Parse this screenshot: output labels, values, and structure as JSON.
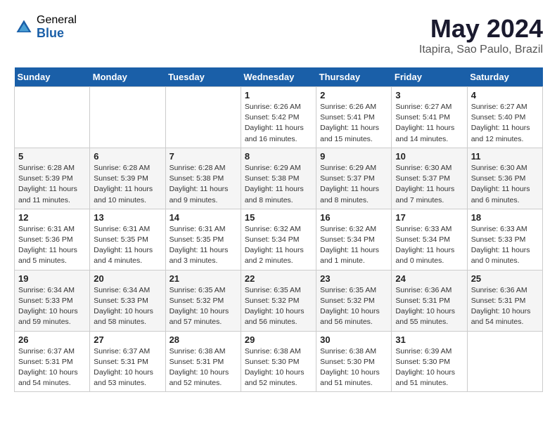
{
  "header": {
    "logo_general": "General",
    "logo_blue": "Blue",
    "month_year": "May 2024",
    "location": "Itapira, Sao Paulo, Brazil"
  },
  "days_of_week": [
    "Sunday",
    "Monday",
    "Tuesday",
    "Wednesday",
    "Thursday",
    "Friday",
    "Saturday"
  ],
  "weeks": [
    {
      "cells": [
        {
          "day": "",
          "info": ""
        },
        {
          "day": "",
          "info": ""
        },
        {
          "day": "",
          "info": ""
        },
        {
          "day": "1",
          "info": "Sunrise: 6:26 AM\nSunset: 5:42 PM\nDaylight: 11 hours and 16 minutes."
        },
        {
          "day": "2",
          "info": "Sunrise: 6:26 AM\nSunset: 5:41 PM\nDaylight: 11 hours and 15 minutes."
        },
        {
          "day": "3",
          "info": "Sunrise: 6:27 AM\nSunset: 5:41 PM\nDaylight: 11 hours and 14 minutes."
        },
        {
          "day": "4",
          "info": "Sunrise: 6:27 AM\nSunset: 5:40 PM\nDaylight: 11 hours and 12 minutes."
        }
      ]
    },
    {
      "cells": [
        {
          "day": "5",
          "info": "Sunrise: 6:28 AM\nSunset: 5:39 PM\nDaylight: 11 hours and 11 minutes."
        },
        {
          "day": "6",
          "info": "Sunrise: 6:28 AM\nSunset: 5:39 PM\nDaylight: 11 hours and 10 minutes."
        },
        {
          "day": "7",
          "info": "Sunrise: 6:28 AM\nSunset: 5:38 PM\nDaylight: 11 hours and 9 minutes."
        },
        {
          "day": "8",
          "info": "Sunrise: 6:29 AM\nSunset: 5:38 PM\nDaylight: 11 hours and 8 minutes."
        },
        {
          "day": "9",
          "info": "Sunrise: 6:29 AM\nSunset: 5:37 PM\nDaylight: 11 hours and 8 minutes."
        },
        {
          "day": "10",
          "info": "Sunrise: 6:30 AM\nSunset: 5:37 PM\nDaylight: 11 hours and 7 minutes."
        },
        {
          "day": "11",
          "info": "Sunrise: 6:30 AM\nSunset: 5:36 PM\nDaylight: 11 hours and 6 minutes."
        }
      ]
    },
    {
      "cells": [
        {
          "day": "12",
          "info": "Sunrise: 6:31 AM\nSunset: 5:36 PM\nDaylight: 11 hours and 5 minutes."
        },
        {
          "day": "13",
          "info": "Sunrise: 6:31 AM\nSunset: 5:35 PM\nDaylight: 11 hours and 4 minutes."
        },
        {
          "day": "14",
          "info": "Sunrise: 6:31 AM\nSunset: 5:35 PM\nDaylight: 11 hours and 3 minutes."
        },
        {
          "day": "15",
          "info": "Sunrise: 6:32 AM\nSunset: 5:34 PM\nDaylight: 11 hours and 2 minutes."
        },
        {
          "day": "16",
          "info": "Sunrise: 6:32 AM\nSunset: 5:34 PM\nDaylight: 11 hours and 1 minute."
        },
        {
          "day": "17",
          "info": "Sunrise: 6:33 AM\nSunset: 5:34 PM\nDaylight: 11 hours and 0 minutes."
        },
        {
          "day": "18",
          "info": "Sunrise: 6:33 AM\nSunset: 5:33 PM\nDaylight: 11 hours and 0 minutes."
        }
      ]
    },
    {
      "cells": [
        {
          "day": "19",
          "info": "Sunrise: 6:34 AM\nSunset: 5:33 PM\nDaylight: 10 hours and 59 minutes."
        },
        {
          "day": "20",
          "info": "Sunrise: 6:34 AM\nSunset: 5:33 PM\nDaylight: 10 hours and 58 minutes."
        },
        {
          "day": "21",
          "info": "Sunrise: 6:35 AM\nSunset: 5:32 PM\nDaylight: 10 hours and 57 minutes."
        },
        {
          "day": "22",
          "info": "Sunrise: 6:35 AM\nSunset: 5:32 PM\nDaylight: 10 hours and 56 minutes."
        },
        {
          "day": "23",
          "info": "Sunrise: 6:35 AM\nSunset: 5:32 PM\nDaylight: 10 hours and 56 minutes."
        },
        {
          "day": "24",
          "info": "Sunrise: 6:36 AM\nSunset: 5:31 PM\nDaylight: 10 hours and 55 minutes."
        },
        {
          "day": "25",
          "info": "Sunrise: 6:36 AM\nSunset: 5:31 PM\nDaylight: 10 hours and 54 minutes."
        }
      ]
    },
    {
      "cells": [
        {
          "day": "26",
          "info": "Sunrise: 6:37 AM\nSunset: 5:31 PM\nDaylight: 10 hours and 54 minutes."
        },
        {
          "day": "27",
          "info": "Sunrise: 6:37 AM\nSunset: 5:31 PM\nDaylight: 10 hours and 53 minutes."
        },
        {
          "day": "28",
          "info": "Sunrise: 6:38 AM\nSunset: 5:31 PM\nDaylight: 10 hours and 52 minutes."
        },
        {
          "day": "29",
          "info": "Sunrise: 6:38 AM\nSunset: 5:30 PM\nDaylight: 10 hours and 52 minutes."
        },
        {
          "day": "30",
          "info": "Sunrise: 6:38 AM\nSunset: 5:30 PM\nDaylight: 10 hours and 51 minutes."
        },
        {
          "day": "31",
          "info": "Sunrise: 6:39 AM\nSunset: 5:30 PM\nDaylight: 10 hours and 51 minutes."
        },
        {
          "day": "",
          "info": ""
        }
      ]
    }
  ]
}
